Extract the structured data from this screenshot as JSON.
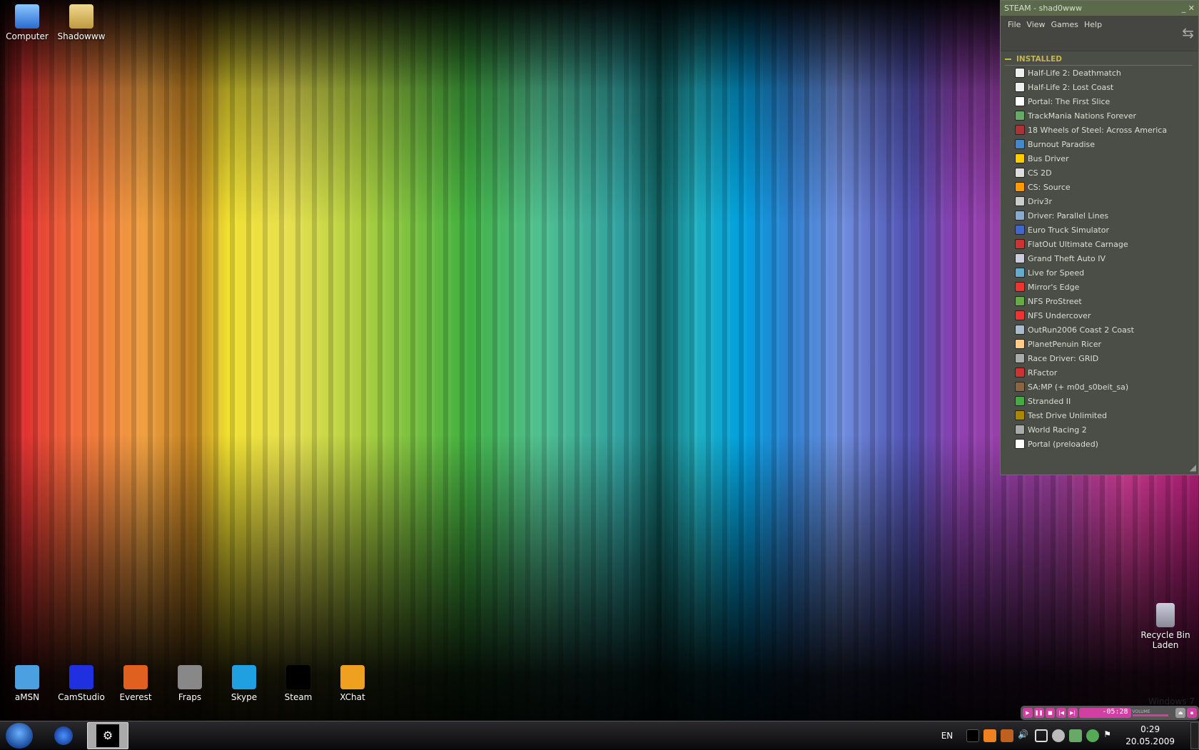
{
  "desktop": {
    "top_icons": [
      {
        "label": "Computer",
        "icon": "computer-icon"
      },
      {
        "label": "Shadowww",
        "icon": "folder-icon"
      }
    ],
    "bottom_icons": [
      {
        "label": "aMSN"
      },
      {
        "label": "CamStudio"
      },
      {
        "label": "Everest"
      },
      {
        "label": "Fraps"
      },
      {
        "label": "Skype"
      },
      {
        "label": "Steam"
      },
      {
        "label": "XChat"
      }
    ],
    "recycle_bin": {
      "line1": "Recycle Bin",
      "line2": "Laden"
    },
    "watermark": "Windows 7"
  },
  "steam": {
    "title": "STEAM - shad0www",
    "menu": [
      "File",
      "View",
      "Games",
      "Help"
    ],
    "section": "INSTALLED",
    "games": [
      "Half-Life 2: Deathmatch",
      "Half-Life 2: Lost Coast",
      "Portal: The First Slice",
      "TrackMania Nations Forever",
      "18 Wheels of Steel: Across America",
      "Burnout Paradise",
      "Bus Driver",
      "CS 2D",
      "CS: Source",
      "Driv3r",
      "Driver: Parallel Lines",
      "Euro Truck Simulator",
      "FlatOut Ultimate Carnage",
      "Grand Theft Auto IV",
      "Live for Speed",
      "Mirror's Edge",
      "NFS ProStreet",
      "NFS Undercover",
      "OutRun2006 Coast 2 Coast",
      "PlanetPenuin Ricer",
      "Race Driver: GRID",
      "RFactor",
      "SA:MP (+ m0d_s0beit_sa)",
      "Stranded II",
      "Test Drive Unlimited",
      "World Racing 2",
      "Portal (preloaded)"
    ]
  },
  "player": {
    "time": "-05:28",
    "volume_label": "VOLUME",
    "volume": 0.85
  },
  "taskbar": {
    "language": "EN",
    "time": "0:29",
    "date": "20.05.2009"
  },
  "colors": {
    "steam_title": "#5a6a4a",
    "steam_section": "#c4b550",
    "player_accent": "#d040a0"
  }
}
